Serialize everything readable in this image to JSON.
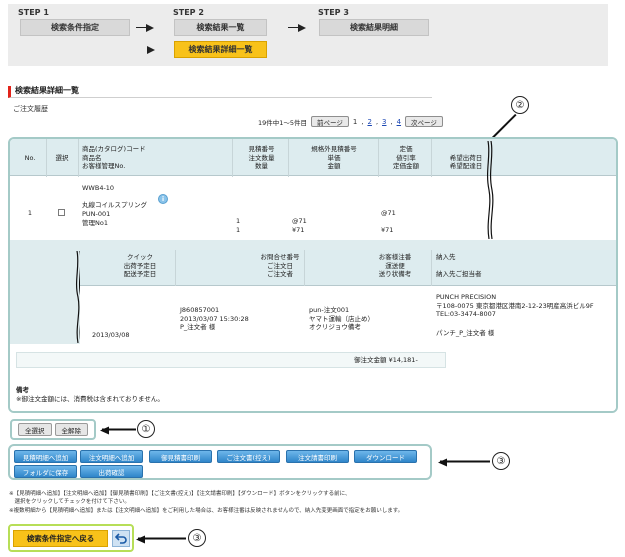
{
  "steps": {
    "step1_label": "STEP 1",
    "step1_box": "検索条件指定",
    "step2_label": "STEP 2",
    "step2_box": "検索結果一覧",
    "step2_sub_box": "検索結果詳細一覧",
    "step3_label": "STEP 3",
    "step3_box": "検索結果明細"
  },
  "section_title": "検索結果詳細一覧",
  "sub_title": "ご注文履歴",
  "pager": {
    "summary": "19件中1～5件目",
    "prev": "前ページ",
    "pages": [
      "1",
      "2",
      "3",
      "4"
    ],
    "current": "1",
    "next": "次ページ",
    "separator": ","
  },
  "callouts": [
    "①",
    "②",
    "③",
    "③"
  ],
  "table": {
    "header": {
      "no": "No.",
      "select": "選択",
      "product": [
        "商品(カタログ)コード",
        "商品名",
        "お客様管理No."
      ],
      "quote": [
        "見積番号",
        "注文数量",
        "数量"
      ],
      "spec": [
        "規格外見積番号",
        "単価",
        "金額"
      ],
      "price": [
        "定価",
        "値引率",
        "定価金額"
      ],
      "delivery": [
        "希望出荷日",
        "希望配達日"
      ]
    },
    "row": {
      "no": "1",
      "code": "WWB4-10",
      "name": "丸線コイルスプリング",
      "pun": "PUN-001",
      "manage": "管理No1",
      "qty1": "1",
      "qty2": "1",
      "spec1": "@71",
      "spec2": "¥71",
      "price1": "@71",
      "price2": "¥71"
    },
    "subheader": {
      "quick": [
        "クイック",
        "出荷予定日",
        "配送予定日"
      ],
      "inquiry": [
        "お問合せ番号",
        "ご注文日",
        "ご注文者"
      ],
      "customer": [
        "お客様注番",
        "運送便",
        "送り状備考"
      ],
      "dest": [
        "納入先",
        "",
        "納入先ご担当者"
      ]
    },
    "subrow": {
      "date": "2013/03/08",
      "inquiry_no": "J860857001",
      "order_date": "2013/03/07 15:30:28",
      "orderer": "P_注文者 様",
      "cust_no": "pun-注文001",
      "carrier": "ヤマト運輸（店止め）",
      "note": "オクリジョウ備考",
      "dest_name": "PUNCH PRECISION",
      "dest_addr": "〒108-0075 東京都港区港南2-12-23明産高浜ビル9F",
      "dest_tel": "TEL:03-3474-8007",
      "dest_person": "パンチ_P_注文者 様"
    },
    "total": "御注文金額 ¥14,181-",
    "notes_title": "備考",
    "notes_text": "※御注文金額には、消費税は含まれておりません。"
  },
  "selection": {
    "select_all": "全選択",
    "clear_all": "全解除"
  },
  "actions": [
    "見積明細へ追加",
    "注文明細へ追加",
    "御見積書印刷",
    "ご注文書(控え)",
    "注文請書印刷",
    "ダウンロード",
    "フォルダに保存",
    "出荷確認"
  ],
  "footnotes": [
    "※【見積明細へ追加】【注文明細へ追加】【御見積書印刷】【ご注文書(控え)】【注文請書印刷】【ダウンロード】ボタンをクリックする前に、",
    "　選択をクリックしてチェックを付けて下さい。",
    "※複数明細から【見積明細へ追加】または【注文明細へ追加】をご利用した場合は、お客様注番は反映されませんので、納入先変更画面で指定をお願いします。"
  ],
  "back": {
    "label": "検索条件指定へ戻る"
  },
  "icons": {
    "arrow": "arrow-right-icon",
    "back": "return-arrow-icon",
    "info": "info-bubble-icon"
  },
  "colors": {
    "accent_yellow": "#f8c21a",
    "panel_border": "#a4cac7",
    "header_bg": "#ddecef",
    "button_blue": "#2f86c9",
    "section_red": "#e2231a"
  }
}
